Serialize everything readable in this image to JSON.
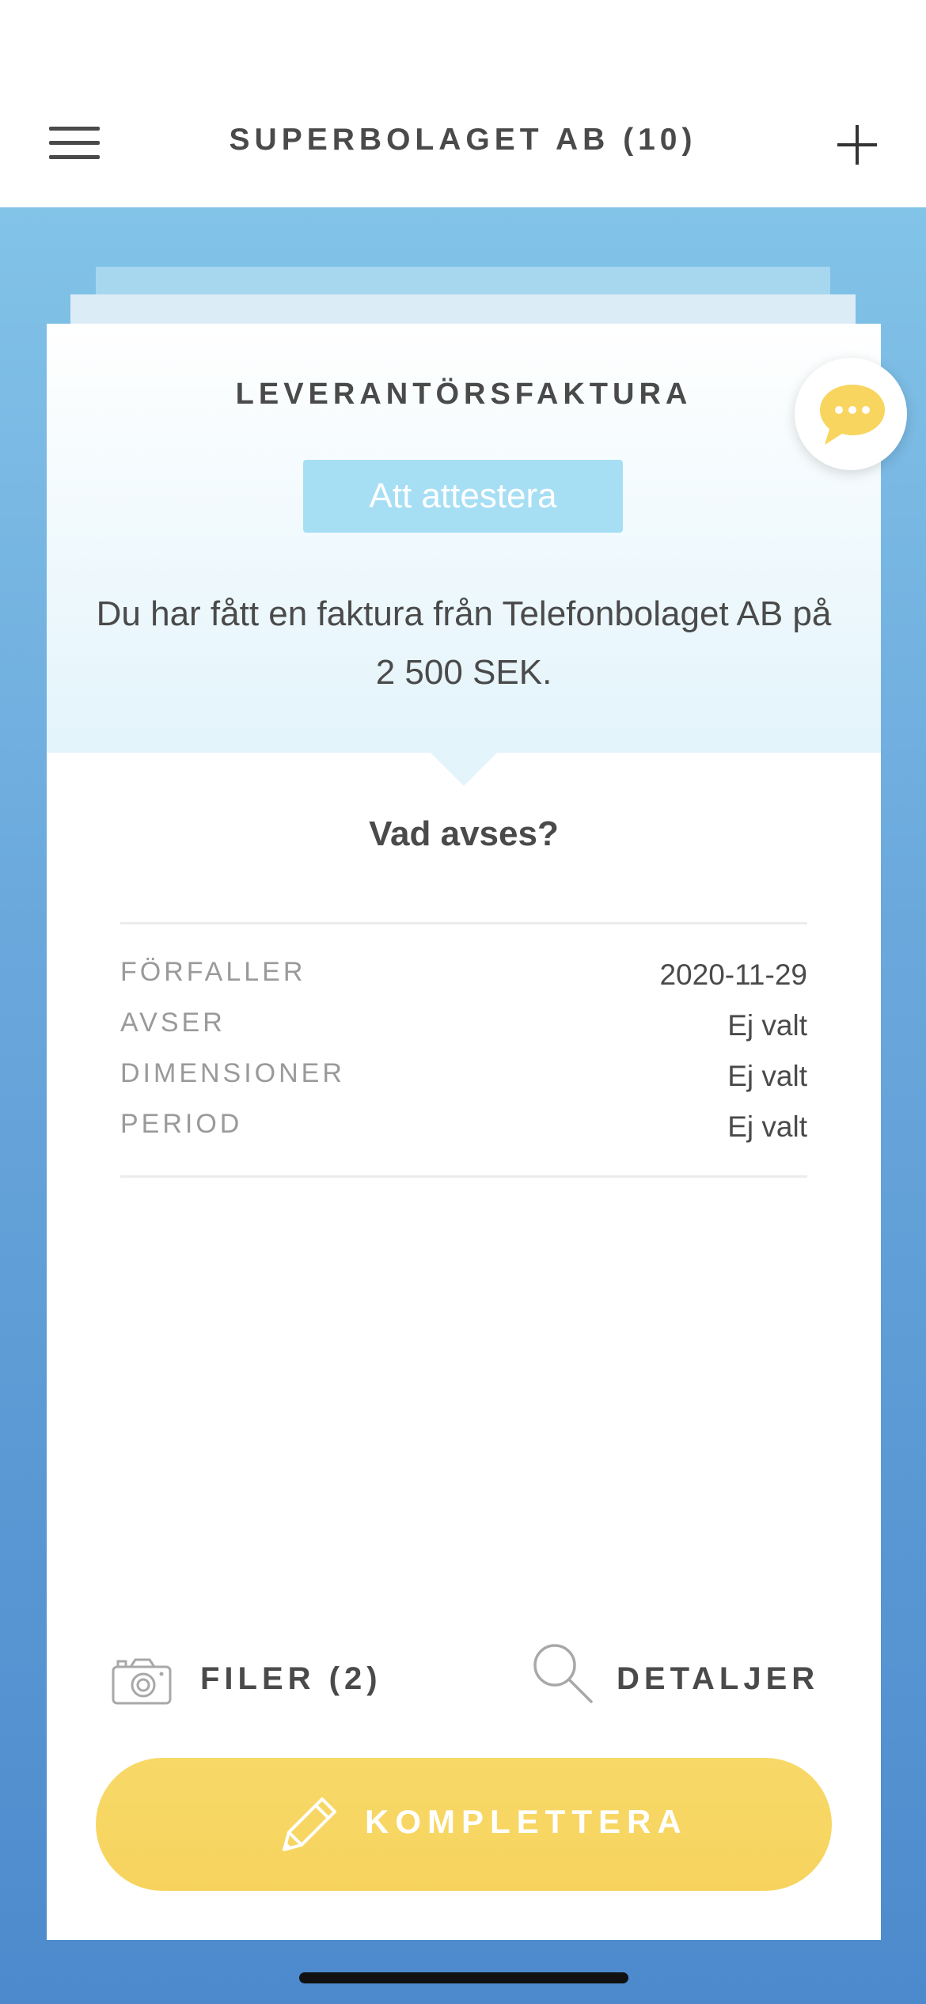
{
  "header": {
    "title": "SUPERBOLAGET AB (10)",
    "menu_icon": "hamburger-menu-icon",
    "add_icon": "plus-icon"
  },
  "card": {
    "title": "LEVERANTÖRSFAKTURA",
    "status": "Att attestera",
    "message": "Du har fått en faktura från Telefonbolaget AB på 2 500 SEK.",
    "section_title": "Vad avses?",
    "details": [
      {
        "label": "FÖRFALLER",
        "value": "2020-11-29"
      },
      {
        "label": "AVSER",
        "value": "Ej valt"
      },
      {
        "label": "DIMENSIONER",
        "value": "Ej valt"
      },
      {
        "label": "PERIOD",
        "value": "Ej valt"
      }
    ]
  },
  "actions": {
    "files_label": "FILER (2)",
    "files_icon": "camera-icon",
    "details_label": "DETALJER",
    "details_icon": "search-icon",
    "complete_label": "KOMPLETTERA",
    "complete_icon": "pencil-icon"
  },
  "chat": {
    "icon": "chat-bubble-icon"
  },
  "colors": {
    "accent_yellow": "#f7d55f",
    "badge_blue": "#a6dff4",
    "background_blue": "#6aa8dc",
    "text_dark": "#4a4a4a"
  }
}
